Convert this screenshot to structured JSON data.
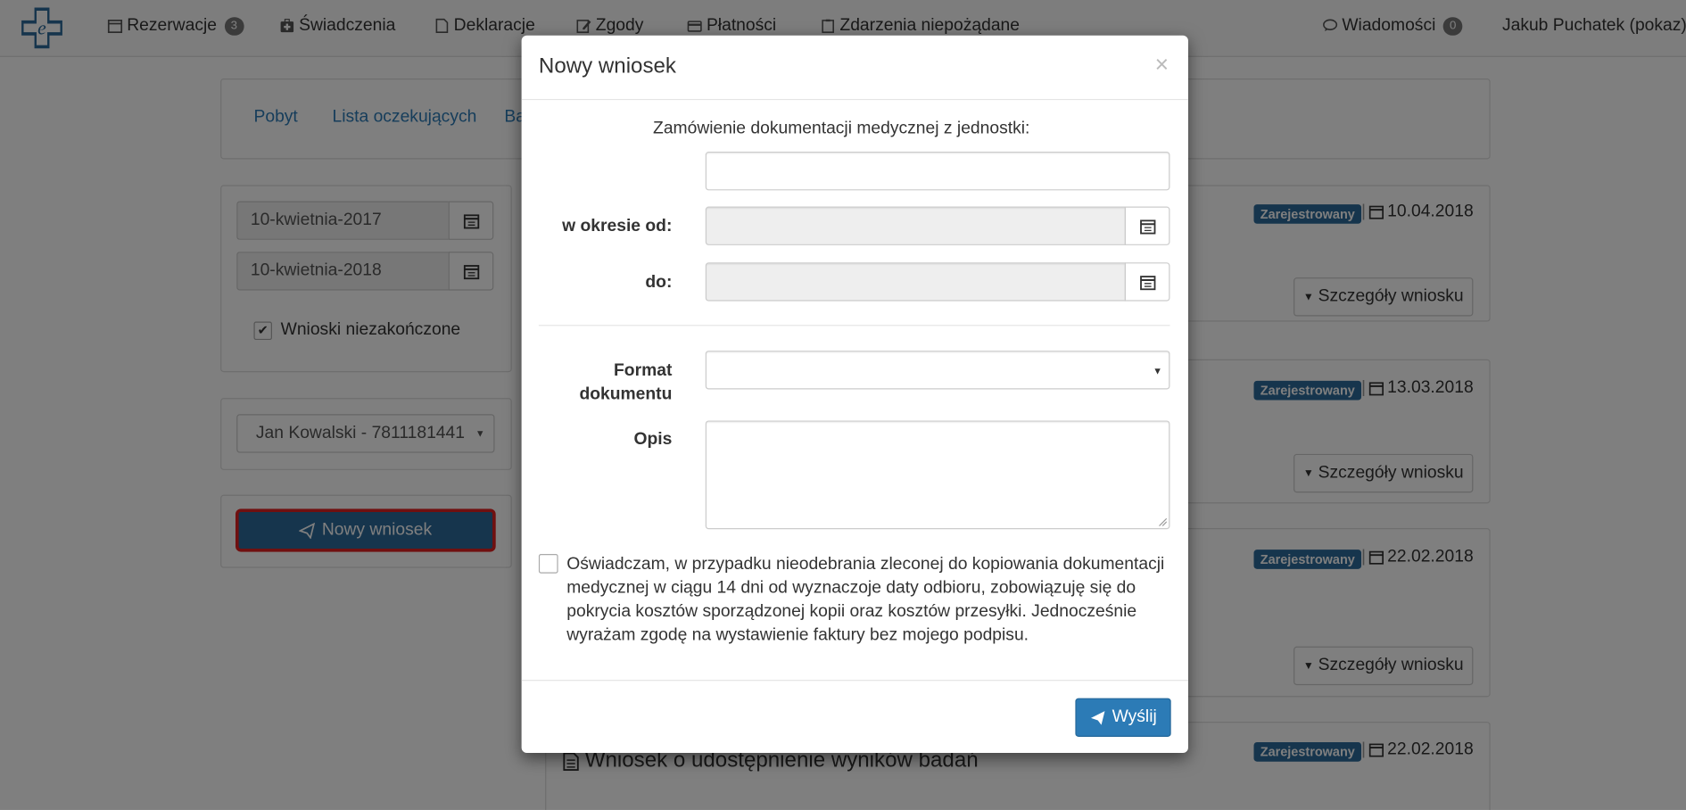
{
  "navbar": {
    "items": [
      {
        "label": "Rezerwacje",
        "badge": "3",
        "icon": "calendar-icon"
      },
      {
        "label": "Świadczenia",
        "icon": "medkit-icon"
      },
      {
        "label": "Deklaracje",
        "icon": "file-icon"
      },
      {
        "label": "Zgody",
        "icon": "edit-icon"
      },
      {
        "label": "Płatności",
        "icon": "credit-card-icon"
      },
      {
        "label": "Zdarzenia niepożądane",
        "icon": "clipboard-icon"
      }
    ],
    "messages": {
      "label": "Wiadomości",
      "badge": "0",
      "icon": "comments-icon"
    },
    "user": "Jakub Puchatek (pokaz)"
  },
  "tabs": [
    "Pobyt",
    "Lista oczekujących",
    "Ba"
  ],
  "filters": {
    "date_from": "10-kwietnia-2017",
    "date_to": "10-kwietnia-2018",
    "checkbox_label": "Wnioski niezakończone",
    "patient": "Jan Kowalski - 7811181441",
    "new_request": "Nowy wniosek"
  },
  "requests": [
    {
      "status": "Zarejestrowany",
      "date": "10.04.2018",
      "details": "Szczegóły wniosku"
    },
    {
      "status": "Zarejestrowany",
      "date": "13.03.2018",
      "details": "Szczegóły wniosku"
    },
    {
      "status": "Zarejestrowany",
      "date": "22.02.2018",
      "details": "Szczegóły wniosku"
    },
    {
      "status": "Zarejestrowany",
      "date": "22.02.2018",
      "title": "Wniosek o udostępnienie wyników badań"
    }
  ],
  "modal": {
    "title": "Nowy wniosek",
    "close": "×",
    "intro": "Zamówienie dokumentacji medycznej z jednostki:",
    "unit_value": "",
    "period_from_label": "w okresie od:",
    "period_to_label": "do:",
    "format_label_1": "Format",
    "format_label_2": "dokumentu",
    "format_value": "",
    "description_label": "Opis",
    "description_value": "",
    "declaration": "Oświadczam, w przypadku nieodebrania zleconej do kopiowania dokumentacji medycznej w ciągu 14 dni od wyznaczoje daty odbioru, zobowiązuję się do pokrycia kosztów sporządzonej kopii oraz kosztów przesyłki. Jednocześnie wyrażam zgodę na wystawienie faktury bez mojego podpisu.",
    "submit": "Wyślij"
  },
  "colors": {
    "primary": "#2c7bb6",
    "badge": "#2c6a9a",
    "highlight": "#e02020"
  }
}
